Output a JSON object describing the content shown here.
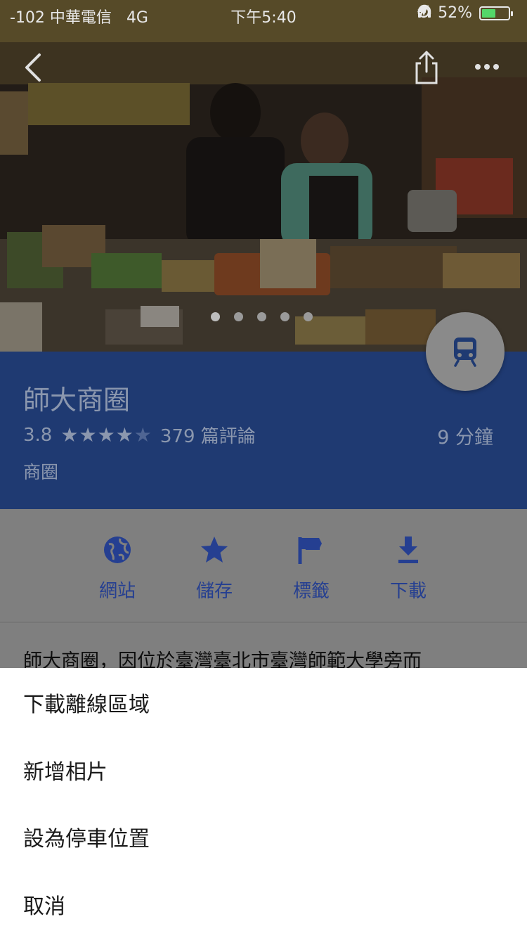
{
  "status_bar": {
    "carrier": "-102 中華電信",
    "network": "4G",
    "time": "下午5:40",
    "battery": "52%",
    "battery_level": 0.52
  },
  "header": {
    "icons": [
      "back-icon",
      "share-icon",
      "more-icon"
    ],
    "photo_dots": 5,
    "active_dot": 1
  },
  "place": {
    "name": "師大商圈",
    "rating": "3.8",
    "rating_value": 3.8,
    "reviews": "379 篇評論",
    "duration": "9 分鐘",
    "category": "商圈",
    "transit_icon": "train-icon"
  },
  "actions": [
    {
      "label": "網站",
      "icon": "globe-icon"
    },
    {
      "label": "儲存",
      "icon": "star-icon"
    },
    {
      "label": "標籤",
      "icon": "flag-icon"
    },
    {
      "label": "下載",
      "icon": "download-icon"
    }
  ],
  "description": "師大商圈，因位於臺灣臺北市臺灣師範大學旁而",
  "sheet": {
    "items": [
      "下載離線區域",
      "新增相片",
      "設為停車位置",
      "取消"
    ]
  },
  "colors": {
    "brand_blue": "#1f3a72",
    "accent_blue": "#253f91",
    "overlay_gray": "#7f7f7f"
  }
}
